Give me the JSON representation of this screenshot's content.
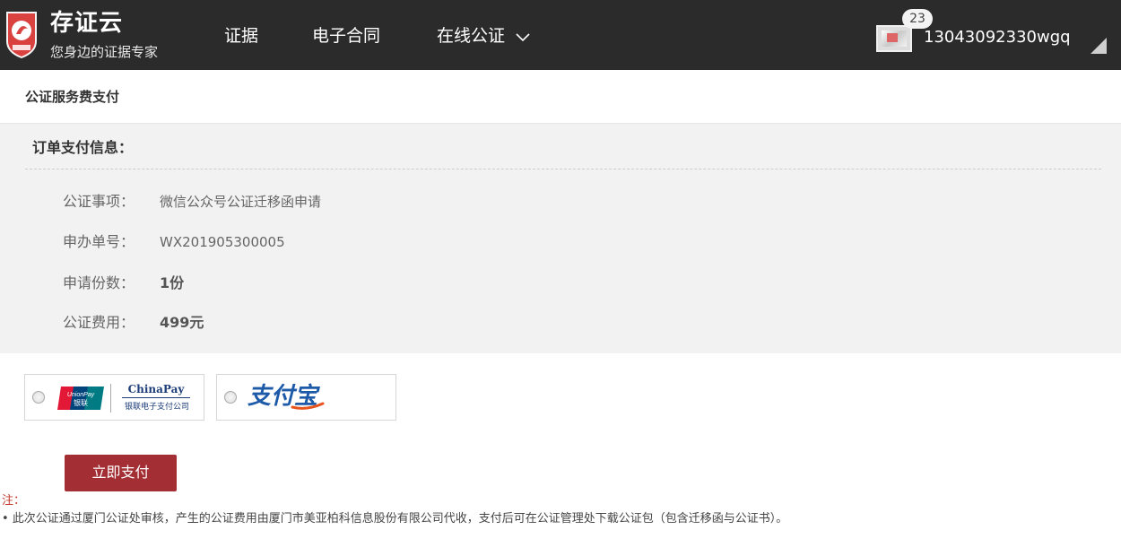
{
  "header": {
    "brand_name": "存证云",
    "brand_slogan": "您身边的证据专家",
    "nav": [
      {
        "label": "证据"
      },
      {
        "label": "电子合同"
      },
      {
        "label": "在线公证"
      }
    ],
    "notification_count": "23",
    "username": "13043092330wgq"
  },
  "page": {
    "title": "公证服务费支付"
  },
  "order": {
    "section_title": "订单支付信息：",
    "fields": [
      {
        "label": "公证事项：",
        "value": "微信公众号公证迁移函申请"
      },
      {
        "label": "申办单号：",
        "value": "WX201905300005"
      },
      {
        "label": "申请份数：",
        "value": "1份"
      },
      {
        "label": "公证费用：",
        "value": "499元"
      }
    ]
  },
  "payment": {
    "options": [
      {
        "id": "chinapay",
        "brand": "ChinaPay",
        "company": "银联电子支付公司",
        "selected": false
      },
      {
        "id": "alipay",
        "brand": "支付宝",
        "selected": false
      }
    ],
    "submit_label": "立即支付"
  },
  "notes": {
    "label": "注：",
    "text": "• 此次公证通过厦门公证处审核，产生的公证费用由厦门市美亚柏科信息股份有限公司代收，支付后可在公证管理处下载公证包（包含迁移函与公证书）。"
  },
  "colors": {
    "header_bg": "#2b2b2b",
    "panel_bg": "#f2f2f2",
    "button_bg": "#a32f35",
    "note_label": "#c0392b",
    "chinapay_blue": "#1d3d78",
    "alipay_blue": "#1d5aa8"
  }
}
